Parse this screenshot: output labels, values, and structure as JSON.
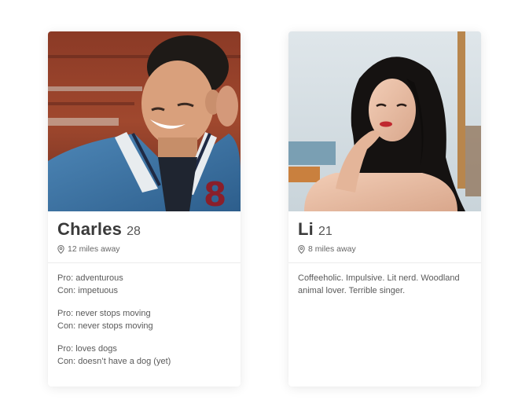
{
  "profiles": [
    {
      "name": "Charles",
      "age": "28",
      "distance": "12 miles away",
      "photo_icon": "portrait-photo",
      "pairs": [
        {
          "pro": "Pro: adventurous",
          "con": "Con: impetuous"
        },
        {
          "pro": "Pro: never stops moving",
          "con": "Con: never stops moving"
        },
        {
          "pro": "Pro: loves dogs",
          "con": "Con: doesn’t have a dog (yet)"
        }
      ]
    },
    {
      "name": "Li",
      "age": "21",
      "distance": "8 miles away",
      "photo_icon": "portrait-photo",
      "bio": "Coffeeholic. Impulsive. Lit nerd. Woodland animal lover. Terrible singer."
    }
  ],
  "colors": {
    "name_text": "#3a3a3a",
    "body_text": "#5a5a5a",
    "divider": "#ececec"
  }
}
